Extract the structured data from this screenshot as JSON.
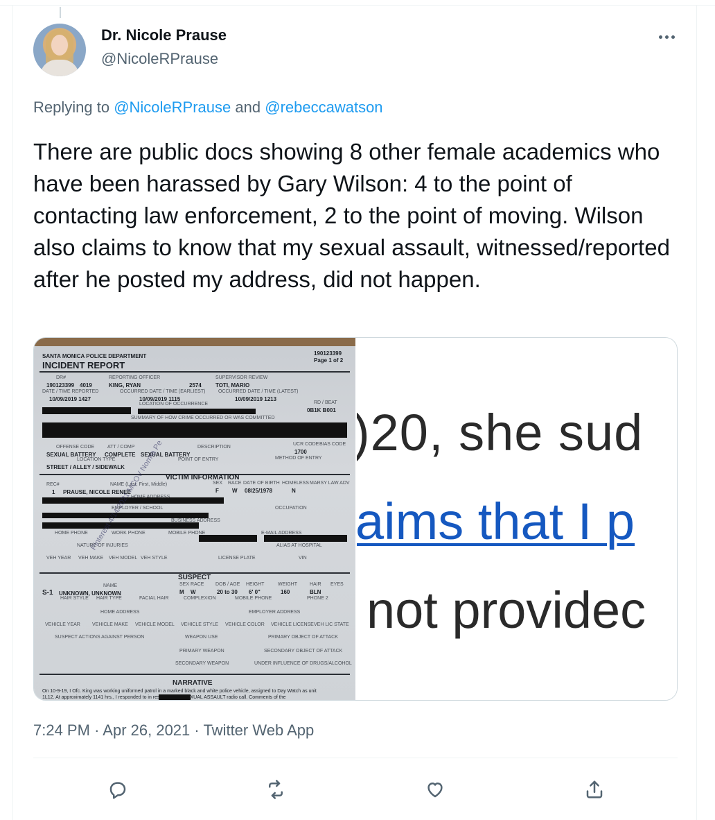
{
  "author": {
    "name": "Dr. Nicole Prause",
    "handle": "@NicoleRPrause"
  },
  "reply": {
    "prefix": "Replying to",
    "mention1": "@NicoleRPrause",
    "connector": "and",
    "mention2": "@rebeccawatson"
  },
  "tweet": {
    "text": "There are public docs showing 8 other female academics who have been harassed by Gary Wilson: 4 to the point of contacting law enforcement, 2 to the point of moving. Wilson also claims to know that my sexual assault, witnessed/reported after he posted my address, did not happen."
  },
  "media": {
    "document": {
      "dept": "SANTA MONICA POLICE DEPARTMENT",
      "title": "INCIDENT REPORT",
      "report_no": "190123399",
      "page": "Page 1 of 2",
      "drn_label": "DR#",
      "drn": "190123399",
      "drn_seq": "4019",
      "reporting_officer_label": "REPORTING OFFICER",
      "reporting_officer": "KING, RYAN",
      "officer_no": "2574",
      "supervisor_label": "SUPERVISOR REVIEW",
      "supervisor": "TOTI, MARIO",
      "dt_reported_label": "DATE / TIME REPORTED",
      "dt_reported": "10/09/2019 1427",
      "occ_earliest_label": "OCCURRED DATE / TIME (EARLIEST)",
      "occ_earliest": "10/09/2019 1115",
      "occ_latest_label": "OCCURRED DATE / TIME (LATEST)",
      "occ_latest": "10/09/2019 1213",
      "location_label": "LOCATION OF OCCURRENCE",
      "beat_label": "RD / BEAT",
      "beat": "0B1K  B001",
      "summary_label": "SUMMARY OF HOW CRIME OCCURRED OR WAS COMMITTED",
      "offense_code_label": "OFFENSE CODE",
      "offense": "SEXUAL BATTERY",
      "attcomp_label": "ATT / COMP",
      "attcomp": "COMPLETE",
      "description_label": "DESCRIPTION",
      "description": "SEXUAL BATTERY",
      "ucr_label": "UCR CODE",
      "ucr": "1700",
      "bias_label": "BIAS CODE",
      "location_type_label": "LOCATION TYPE",
      "location_type": "STREET / ALLEY / SIDEWALK",
      "point_of_entry_label": "POINT OF ENTRY",
      "method_label": "METHOD OF ENTRY",
      "victim_header": "VICTIM INFORMATION",
      "victim_name_label": "NAME (Last, First, Middle)",
      "rec_label": "REC#",
      "rec": "1",
      "victim_name": "PRAUSE, NICOLE RENEE",
      "sex_label": "SEX",
      "victim_sex": "F",
      "race_label": "RACE",
      "victim_race": "W",
      "dob_label": "DATE OF BIRTH",
      "victim_dob": "08/25/1978",
      "homeless_label": "HOMELESS",
      "homeless": "N",
      "marsy_label": "MARSY LAW ADV",
      "home_address_label": "HOME ADDRESS",
      "employer_label": "EMPLOYER / SCHOOL",
      "occupation_label": "OCCUPATION",
      "business_label": "BUSINESS ADDRESS",
      "home_phone_label": "HOME PHONE",
      "work_phone_label": "WORK PHONE",
      "mobile_label": "MOBILE PHONE",
      "email_label": "E-MAIL ADDRESS",
      "injuries_label": "NATURE OF INJURIES",
      "hospital_label": "ALIAS AT HOSPITAL",
      "veh_year_label": "VEH YEAR",
      "veh_make_label": "VEH MAKE",
      "veh_model_label": "VEH MODEL",
      "veh_style_label": "VEH STYLE",
      "plate_label": "LICENSE PLATE",
      "vin_label": "VIN",
      "suspect_header": "SUSPECT",
      "suspect_id": "S-1",
      "suspect_name_label": "NAME",
      "suspect_name": "UNKNOWN, UNKNOWN",
      "suspect_sex": "M",
      "suspect_race": "W",
      "age_label": "DOB / AGE",
      "suspect_age": "20 to 30",
      "height_label": "HEIGHT",
      "suspect_height": "6' 0\"",
      "weight_label": "WEIGHT",
      "suspect_weight": "160",
      "hair_label": "HAIR",
      "suspect_hair": "BLN",
      "eyes_label": "EYES",
      "hair_style_label": "HAIR STYLE",
      "hair_type_label": "HAIR TYPE",
      "facial_hair_label": "FACIAL HAIR",
      "complexion_label": "COMPLEXION",
      "phone2_label": "PHONE 2",
      "employer_addr_label": "EMPLOYER ADDRESS",
      "vehicle_year_label": "VEHICLE YEAR",
      "vehicle_make_label": "VEHICLE MAKE",
      "vehicle_model_label": "VEHICLE MODEL",
      "vehicle_style_label": "VEHICLE STYLE",
      "vehicle_color_label": "VEHICLE COLOR",
      "vehicle_license_label": "VEHICLE LICENSE",
      "veh_lic_state_label": "VEH LIC STATE",
      "suspect_actions_label": "SUSPECT ACTIONS AGAINST PERSON",
      "weapon_use_label": "WEAPON USE",
      "primary_object_label": "PRIMARY OBJECT OF ATTACK",
      "primary_weapon_label": "PRIMARY WEAPON",
      "secondary_object_label": "SECONDARY OBJECT OF ATTACK",
      "secondary_weapon_label": "SECONDARY WEAPON",
      "influence_label": "UNDER INFLUENCE OF DRUGS/ALCOHOL",
      "narrative_header": "NARRATIVE",
      "narrative_line1": "On 10-9-19, I Ofc. King was working uniformed patrol in a marked black and white police vehicle, assigned to Day Watch as unit",
      "narrative_line2": "1L12. At approximately 1141 hrs., I responded to                in response to a SEXUAL ASSAULT radio call. Comments of the",
      "watermark": "Pinterest 4/14/2021 MCOV Norma Pe"
    },
    "zoom": {
      "line1": ")20, she sud",
      "line2": "aims that I p",
      "line3": "not providec"
    }
  },
  "meta": {
    "time": "7:24 PM",
    "sep1": "·",
    "date": "Apr 26, 2021",
    "sep2": "·",
    "source": "Twitter Web App"
  },
  "colors": {
    "link": "#1d9bf0",
    "secondary_text": "#536471",
    "primary_text": "#0f1419",
    "border": "#eff3f4"
  },
  "icons": {
    "reply": "reply-icon",
    "retweet": "retweet-icon",
    "like": "like-icon",
    "share": "share-icon",
    "more": "more-icon"
  }
}
